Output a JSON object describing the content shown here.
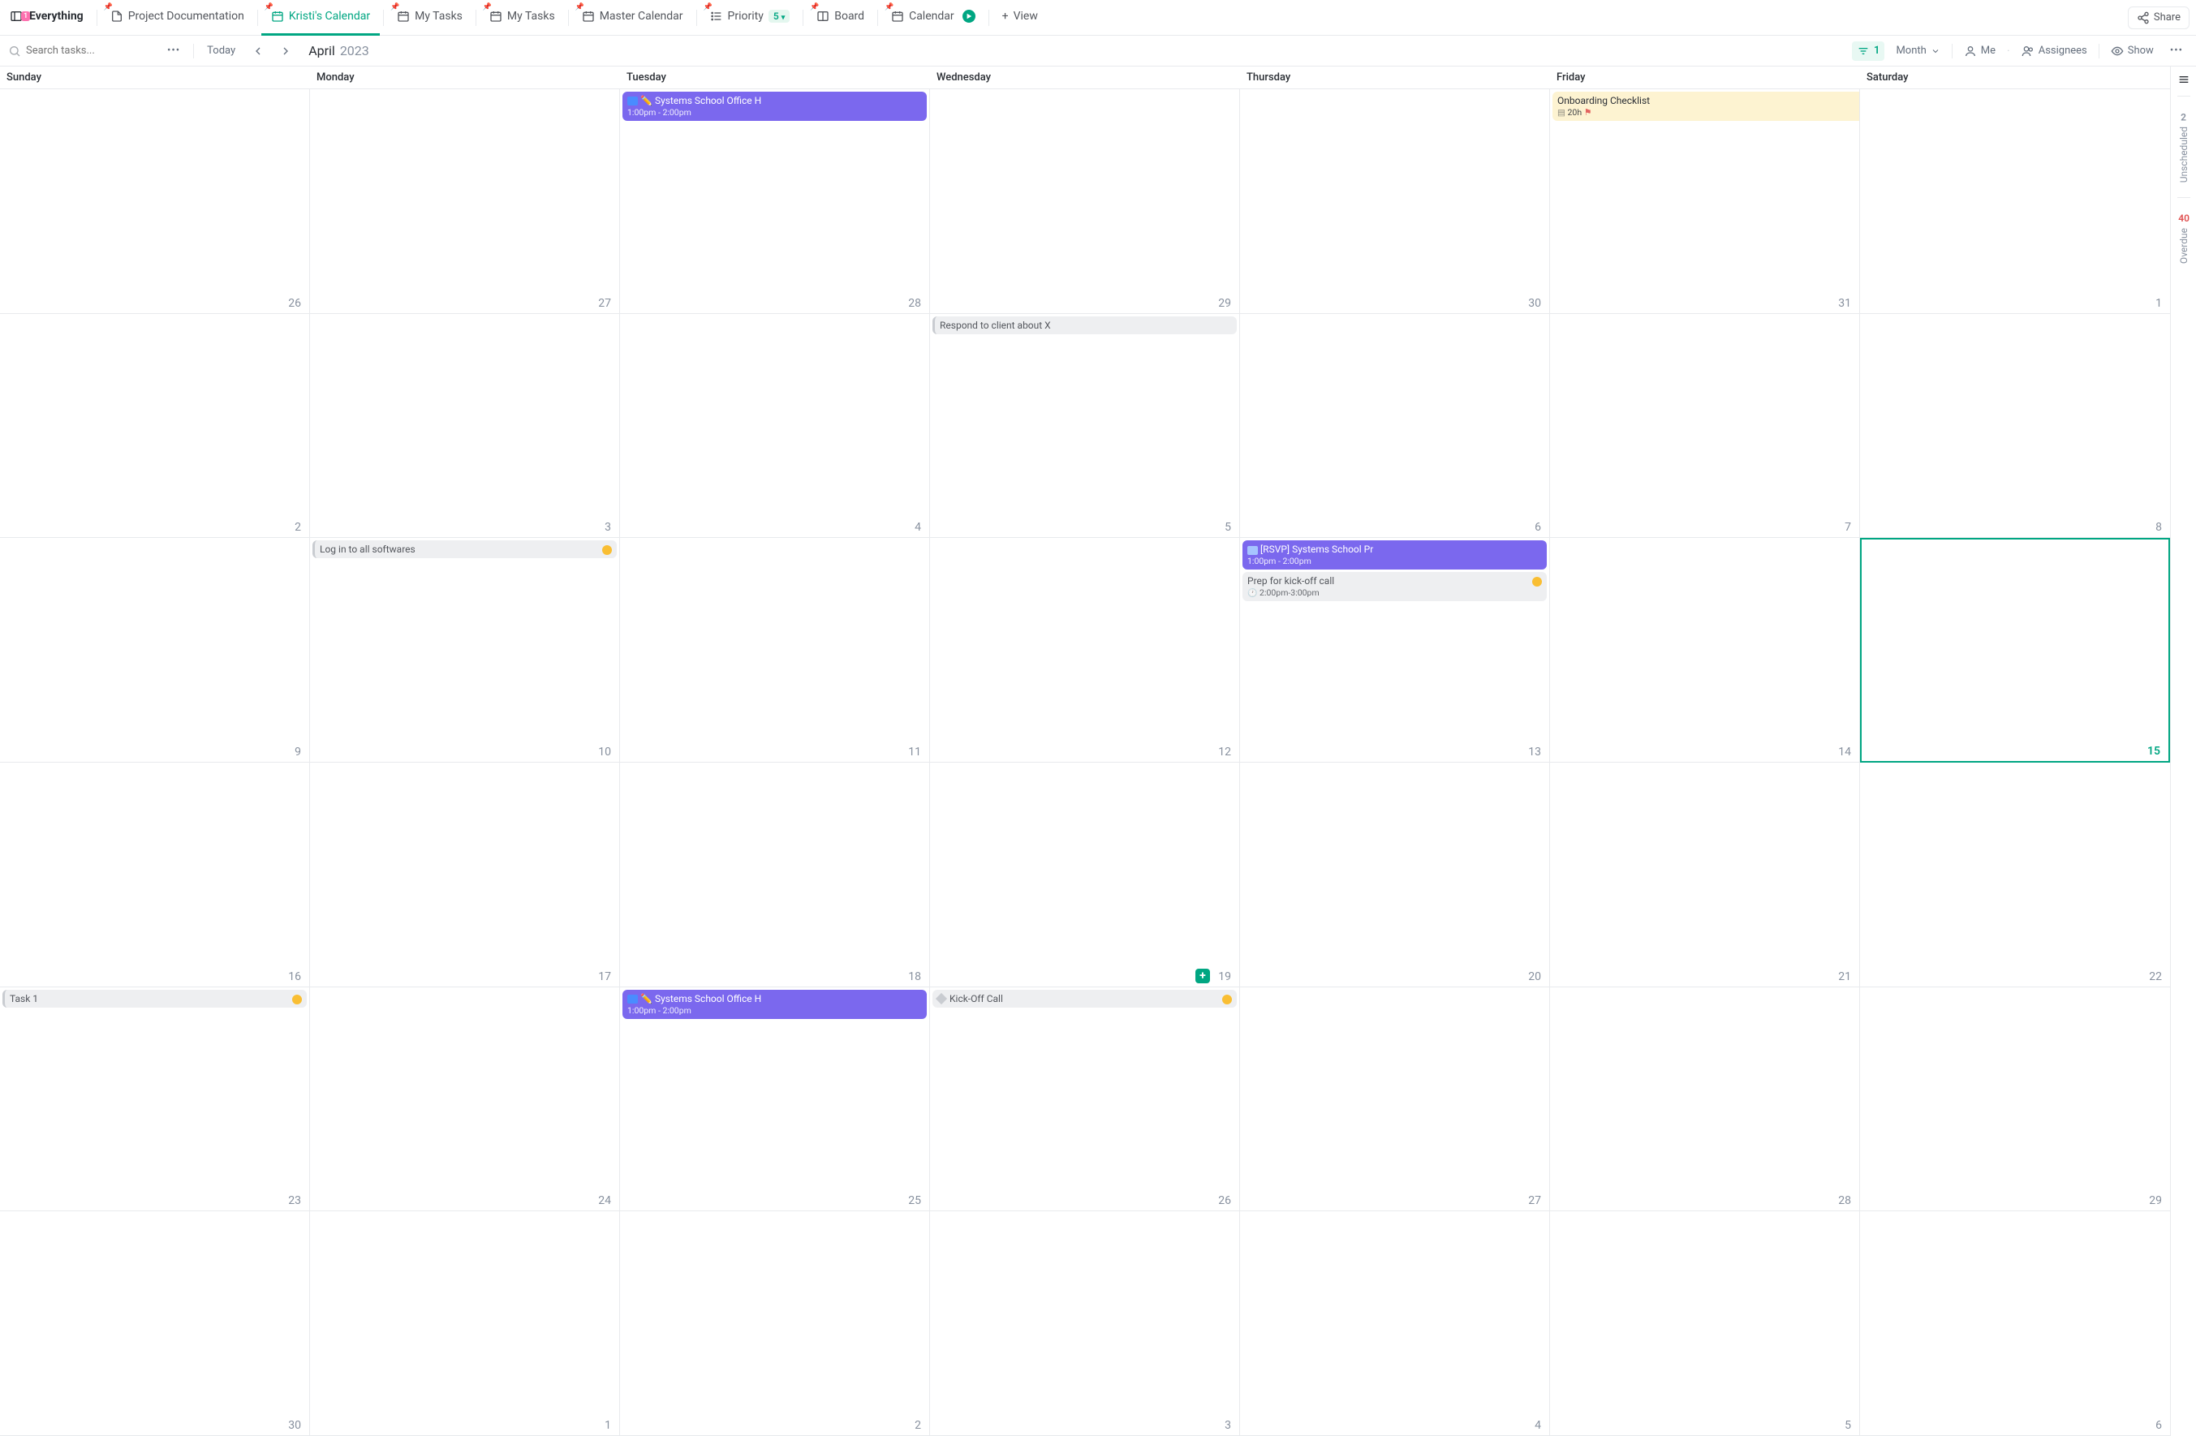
{
  "header": {
    "workspace_badge": "1",
    "workspace_label": "Everything",
    "tabs": [
      {
        "label": "Project Documentation",
        "icon": "doc"
      },
      {
        "label": "Kristi's Calendar",
        "icon": "calendar",
        "active": true
      },
      {
        "label": "My Tasks",
        "icon": "calendar"
      },
      {
        "label": "My Tasks",
        "icon": "calendar"
      },
      {
        "label": "Master Calendar",
        "icon": "calendar"
      },
      {
        "label": "Priority",
        "icon": "list",
        "badge": "5"
      },
      {
        "label": "Board",
        "icon": "board"
      },
      {
        "label": "Calendar",
        "icon": "calendar",
        "play": true
      }
    ],
    "view_label": "View",
    "share_label": "Share"
  },
  "toolbar": {
    "search_placeholder": "Search tasks...",
    "today_label": "Today",
    "month_name": "April",
    "year": "2023",
    "filter_count": "1",
    "range_label": "Month",
    "me_label": "Me",
    "assignees_label": "Assignees",
    "show_label": "Show"
  },
  "days": [
    "Sunday",
    "Monday",
    "Tuesday",
    "Wednesday",
    "Thursday",
    "Friday",
    "Saturday"
  ],
  "cells": [
    {
      "n": "26"
    },
    {
      "n": "27"
    },
    {
      "n": "28",
      "events": [
        {
          "style": "purple",
          "zoom": "dk",
          "emoji": "✏️",
          "title": "Systems School Office H",
          "time": "1:00pm - 2:00pm"
        }
      ]
    },
    {
      "n": "29"
    },
    {
      "n": "30"
    },
    {
      "n": "31",
      "events": [
        {
          "style": "yellow",
          "title": "Onboarding Checklist",
          "sub_icon": "align",
          "sub_text": "20h",
          "flag": true,
          "status": "pink",
          "span": 2
        }
      ]
    },
    {
      "n": "1",
      "covered": true
    },
    {
      "n": "2"
    },
    {
      "n": "3"
    },
    {
      "n": "4"
    },
    {
      "n": "5",
      "events": [
        {
          "style": "gray-left",
          "title": "Respond to client about X"
        }
      ]
    },
    {
      "n": "6"
    },
    {
      "n": "7"
    },
    {
      "n": "8"
    },
    {
      "n": "9"
    },
    {
      "n": "10",
      "events": [
        {
          "style": "gray-left",
          "title": "Log in to all softwares",
          "status": "orange"
        }
      ]
    },
    {
      "n": "11"
    },
    {
      "n": "12"
    },
    {
      "n": "13",
      "events": [
        {
          "style": "purple",
          "zoom": "lt",
          "title": "[RSVP] Systems School Pr",
          "time": "1:00pm - 2:00pm"
        },
        {
          "style": "gray",
          "title": "Prep for kick-off call",
          "clock_time": "2:00pm-3:00pm",
          "status": "orange"
        }
      ]
    },
    {
      "n": "14"
    },
    {
      "n": "15",
      "today": true
    },
    {
      "n": "16"
    },
    {
      "n": "17"
    },
    {
      "n": "18"
    },
    {
      "n": "19",
      "hover": true
    },
    {
      "n": "20"
    },
    {
      "n": "21"
    },
    {
      "n": "22"
    },
    {
      "n": "23",
      "events": [
        {
          "style": "gray-left",
          "title": "Task 1",
          "status": "orange"
        }
      ]
    },
    {
      "n": "24"
    },
    {
      "n": "25",
      "events": [
        {
          "style": "purple",
          "zoom": "dk",
          "emoji": "✏️",
          "title": "Systems School Office H",
          "time": "1:00pm - 2:00pm"
        }
      ]
    },
    {
      "n": "26",
      "events": [
        {
          "style": "gray",
          "diamond": true,
          "title": "Kick-Off Call",
          "status": "orange"
        }
      ]
    },
    {
      "n": "27"
    },
    {
      "n": "28"
    },
    {
      "n": "29"
    },
    {
      "n": "30"
    },
    {
      "n": "1"
    },
    {
      "n": "2"
    },
    {
      "n": "3"
    },
    {
      "n": "4"
    },
    {
      "n": "5"
    },
    {
      "n": "6"
    }
  ],
  "side": {
    "unscheduled_label": "Unscheduled",
    "unscheduled_count": "2",
    "overdue_label": "Overdue",
    "overdue_count": "40"
  }
}
